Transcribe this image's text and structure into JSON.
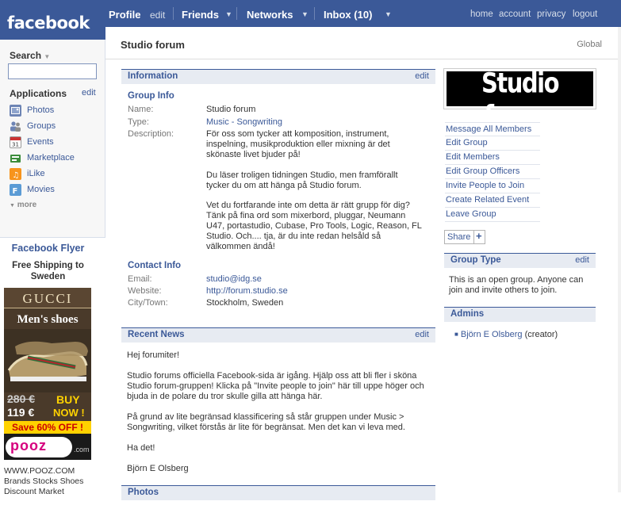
{
  "topnav": {
    "logo": "facebook",
    "profile": "Profile",
    "edit": "edit",
    "friends": "Friends",
    "networks": "Networks",
    "inbox": "Inbox (10)",
    "home": "home",
    "account": "account",
    "privacy": "privacy",
    "logout": "logout"
  },
  "sidebar": {
    "search_label": "Search",
    "apps_title": "Applications",
    "apps_edit": "edit",
    "apps": [
      {
        "label": "Photos",
        "icon": "photos-icon"
      },
      {
        "label": "Groups",
        "icon": "groups-icon"
      },
      {
        "label": "Events",
        "icon": "events-icon"
      },
      {
        "label": "Marketplace",
        "icon": "marketplace-icon"
      },
      {
        "label": "iLike",
        "icon": "ilike-icon"
      },
      {
        "label": "Movies",
        "icon": "movies-icon"
      }
    ],
    "more": "more"
  },
  "flyer": {
    "title": "Facebook Flyer",
    "subtitle1": "Free Shipping to",
    "subtitle2": "Sweden",
    "brand": "GUCCI",
    "product": "Men's shoes",
    "old_price": "280 €",
    "new_price": "119 €",
    "buy": "BUY",
    "now": "NOW !",
    "save": "Save 60% OFF !",
    "pooz": "pooz",
    "pooz_com": ".com",
    "line1": "WWW.POOZ.COM",
    "line2": "Brands Stocks Shoes",
    "line3": "Discount Market"
  },
  "main": {
    "title": "Studio forum",
    "global": "Global",
    "info_title": "Information",
    "info_edit": "edit",
    "group_info": "Group Info",
    "name_lbl": "Name:",
    "name_val": "Studio forum",
    "type_lbl": "Type:",
    "type_music": "Music",
    "type_dash": " - ",
    "type_song": "Songwriting",
    "desc_lbl": "Description:",
    "desc_p1": "För oss som tycker att komposition, instrument, inspelning, musikproduktion eller mixning är det skönaste livet bjuder på!",
    "desc_p2": "Du läser troligen tidningen Studio, men framförallt tycker du om att hänga på Studio forum.",
    "desc_p3": "Vet du fortfarande inte om detta är rätt grupp för dig? Tänk på fina ord som mixerbord, pluggar, Neumann U47, portastudio, Cubase, Pro Tools, Logic, Reason, FL Studio. Och.... tja, är du inte redan helsåld så välkommen ändå!",
    "contact_title": "Contact Info",
    "email_lbl": "Email:",
    "email_val": "studio@idg.se",
    "web_lbl": "Website:",
    "web_val": "http://forum.studio.se",
    "city_lbl": "City/Town:",
    "city_val": "Stockholm, Sweden",
    "news_title": "Recent News",
    "news_edit": "edit",
    "news_p1": "Hej forumiter!",
    "news_p2": "Studio forums officiella Facebook-sida är igång. Hjälp oss att bli fler i sköna Studio forum-gruppen! Klicka på \"Invite people to join\" här till uppe höger och bjuda in de polare du tror skulle gilla att hänga här.",
    "news_p3": "På grund av lite begränsad klassificering så står gruppen under Music > Songwriting, vilket förstås är lite för begränsat. Men det kan vi leva med.",
    "news_p4": "Ha det!",
    "news_p5": "Björn E Olsberg",
    "photos_title": "Photos"
  },
  "right": {
    "logo_text": "Studio forum",
    "actions": [
      "Message All Members",
      "Edit Group",
      "Edit Members",
      "Edit Group Officers",
      "Invite People to Join",
      "Create Related Event",
      "Leave Group"
    ],
    "share": "Share",
    "share_plus": "+",
    "grouptype_title": "Group Type",
    "grouptype_edit": "edit",
    "grouptype_text": "This is an open group. Anyone can join and invite others to join.",
    "admins_title": "Admins",
    "admin_name": "Björn E Olsberg",
    "admin_role": " (creator)"
  },
  "colors": {
    "brand": "#3b5998",
    "section_bg": "#e7ebf2"
  }
}
